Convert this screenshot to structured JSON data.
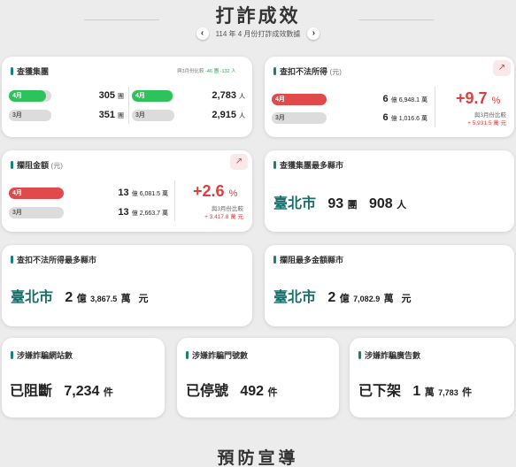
{
  "header": {
    "title": "打詐成效",
    "subtitle": "114 年 4 月份打詐成效數據",
    "prev": "‹",
    "next": "›"
  },
  "labels": {
    "apr": "4月",
    "mar": "3月",
    "compare_prev": "與3月份比較"
  },
  "groups": {
    "title": "查獲集團",
    "legend_prefix": "與3月份比較",
    "legend_a": "-46 團",
    "legend_b": "-132 人",
    "apr_groups": "305",
    "mar_groups": "351",
    "unit_group": "團",
    "apr_people": "2,783",
    "mar_people": "2,915",
    "unit_people": "人"
  },
  "seized": {
    "title": "查扣不法所得",
    "unit": "(元)",
    "apr_yi": "6",
    "apr_wan": "6,948.1",
    "mar_yi": "6",
    "mar_wan": "1,016.6",
    "pct": "+9.7",
    "pct_unit": "%",
    "diff": "+ 5,931.5 萬 元"
  },
  "blocked": {
    "title": "攔阻金額",
    "unit": "(元)",
    "apr_yi": "13",
    "apr_wan": "6,081.5",
    "mar_yi": "13",
    "mar_wan": "2,663.7",
    "pct": "+2.6",
    "pct_unit": "%",
    "diff": "+ 3,417.8 萬 元"
  },
  "units": {
    "yi": "億",
    "wan": "萬",
    "yuan": "元",
    "jian": "件",
    "tuan": "團",
    "ren": "人"
  },
  "most_groups": {
    "title": "查獲集團最多縣市",
    "city": "臺北市",
    "groups": "93",
    "people": "908"
  },
  "most_seized": {
    "title": "查扣不法所得最多縣市",
    "city": "臺北市",
    "yi": "2",
    "wan": "3,867.5"
  },
  "most_blocked": {
    "title": "攔阻最多金額縣市",
    "city": "臺北市",
    "yi": "2",
    "wan": "7,082.9"
  },
  "websites": {
    "title": "涉嫌詐騙網站數",
    "prefix": "已阻斷",
    "value": "7,234"
  },
  "phones": {
    "title": "涉嫌詐騙門號數",
    "prefix": "已停號",
    "value": "492"
  },
  "ads": {
    "title": "涉嫌詐騙廣告數",
    "prefix": "已下架",
    "wan": "1",
    "value": "7,783"
  },
  "footer": {
    "title": "預防宣導"
  },
  "colors": {
    "accent": "#1a7f7a",
    "green": "#2ec35a",
    "red": "#e04a4a",
    "gray": "#dcdcdc",
    "city": "#1a6f6b"
  },
  "bars": {
    "groups_apr_frac": 0.87,
    "groups_mar_frac": 1.0,
    "people_apr_frac": 0.95,
    "people_mar_frac": 1.0,
    "seized_apr_frac": 1.0,
    "seized_mar_frac": 0.3,
    "blocked_apr_frac": 1.0,
    "blocked_mar_frac": 0.35
  },
  "icons": {
    "trend": "trend-up-icon",
    "prev": "chevron-left-icon",
    "next": "chevron-right-icon"
  }
}
